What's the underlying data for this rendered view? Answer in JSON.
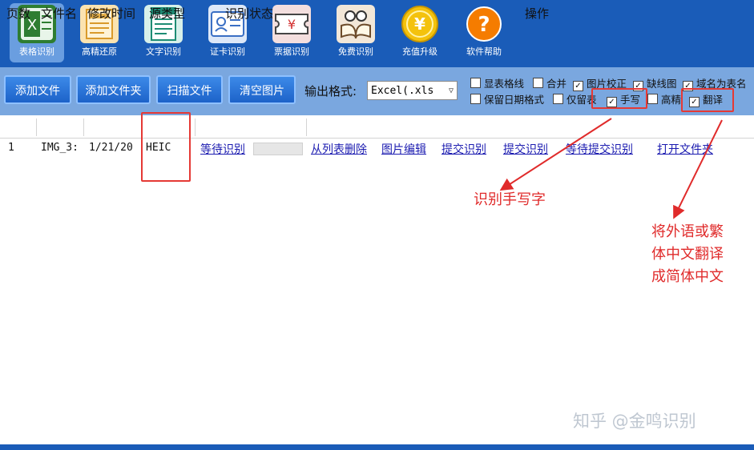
{
  "ribbon": [
    {
      "label": "表格识别",
      "icon": "excel-icon"
    },
    {
      "label": "高精还原",
      "icon": "document-layout-icon"
    },
    {
      "label": "文字识别",
      "icon": "text-document-icon"
    },
    {
      "label": "证卡识别",
      "icon": "id-card-icon"
    },
    {
      "label": "票据识别",
      "icon": "ticket-icon"
    },
    {
      "label": "免费识别",
      "icon": "reading-book-icon"
    },
    {
      "label": "充值升级",
      "icon": "yen-coin-icon"
    },
    {
      "label": "软件帮助",
      "icon": "help-icon"
    }
  ],
  "toolbar": {
    "add_file": "添加文件",
    "add_folder": "添加文件夹",
    "scan_file": "扫描文件",
    "clear_images": "清空图片",
    "format_label": "输出格式:",
    "format_value": "Excel(.xls"
  },
  "options": {
    "show_grid": "显表格线",
    "merge": "合并",
    "image_correct": "图片校正",
    "missing_lines": "缺线图",
    "domain_as_name": "域名为表名",
    "keep_date": "保留日期格式",
    "only_table": "仅留表",
    "handwriting": "手写",
    "high_precision": "高精",
    "translate": "翻译",
    "check_mark": "✓"
  },
  "table": {
    "headers": [
      "页数",
      "文件名",
      "修改时间",
      "源类型",
      "识别状态",
      "操作"
    ],
    "row": {
      "page": "1",
      "filename": "IMG_3:",
      "modified": "1/21/20",
      "source_type": "HEIC",
      "status": "等待识别"
    },
    "actions": [
      "从列表删除",
      "图片编辑",
      "提交识别",
      "提交识别",
      "等待提交识别",
      "打开文件夹"
    ]
  },
  "annotations": {
    "handwriting": "识别手写字",
    "translate_lines": [
      "将外语或繁",
      "体中文翻译",
      "成简体中文"
    ]
  },
  "watermark": "知乎 @金鸣识别",
  "colors": {
    "ribbon": "#1a5cb8",
    "toolbar": "#7aa7df",
    "annotation": "#e02b2b",
    "link": "#1b1bb0"
  }
}
